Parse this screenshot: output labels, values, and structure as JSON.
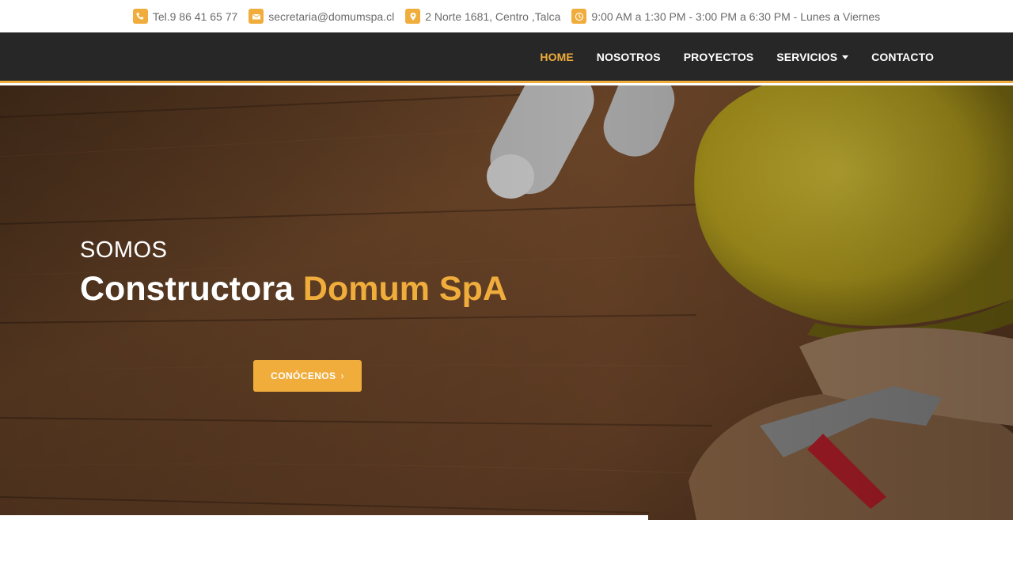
{
  "topbar": {
    "phone": "Tel.9 86 41 65 77",
    "email": "secretaria@domumspa.cl",
    "address": "2 Norte 1681, Centro ,Talca",
    "hours": "9:00 AM a 1:30 PM - 3:00 PM a 6:30 PM - Lunes a Viernes",
    "icons": [
      "phone-icon",
      "mail-icon",
      "location-pin-icon",
      "clock-icon"
    ]
  },
  "nav": {
    "items": [
      {
        "label": "HOME",
        "active": true
      },
      {
        "label": "NOSOTROS"
      },
      {
        "label": "PROYECTOS"
      },
      {
        "label": "SERVICIOS",
        "dropdown": true
      },
      {
        "label": "CONTACTO"
      }
    ]
  },
  "hero": {
    "subtitle": "SOMOS",
    "title_main": "Constructora",
    "title_accent": "Domum SpA",
    "cta_label": "CONÓCENOS",
    "cta_icon": "chevron-right-icon"
  },
  "colors": {
    "accent": "#f0ad3c",
    "nav_bg": "#272727",
    "text_muted": "#6b6b6b"
  }
}
